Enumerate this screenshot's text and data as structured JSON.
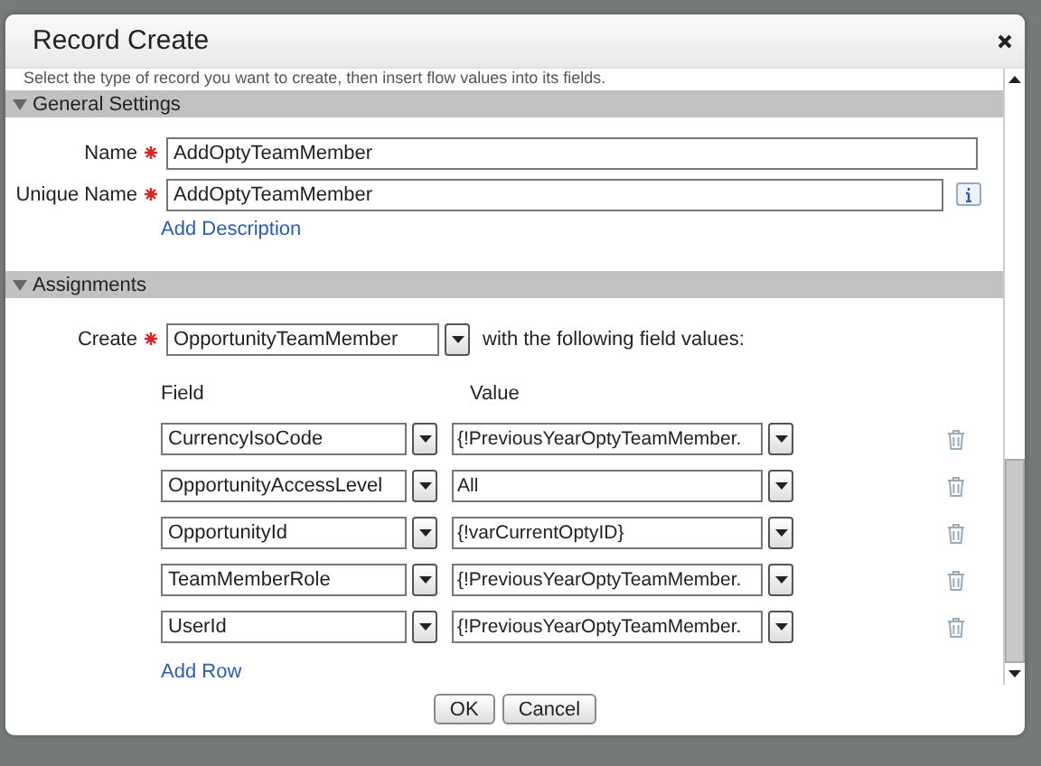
{
  "dialog": {
    "title": "Record Create"
  },
  "intro": "Select the type of record you want to create, then insert flow values into its fields.",
  "general": {
    "title": "General Settings",
    "expanded": true,
    "name": {
      "label": "Name",
      "required": true,
      "value": "AddOptyTeamMember"
    },
    "unique_name": {
      "label": "Unique Name",
      "required": true,
      "value": "AddOptyTeamMember"
    },
    "add_description": "Add Description"
  },
  "assignments": {
    "title": "Assignments",
    "expanded": true,
    "create": {
      "label": "Create",
      "required": true,
      "value": "OpportunityTeamMember",
      "suffix": "with the following field values:"
    },
    "columns": [
      "Field",
      "Value"
    ],
    "rows": [
      {
        "field": "CurrencyIsoCode",
        "value": "{!PreviousYearOptyTeamMember."
      },
      {
        "field": "OpportunityAccessLevel",
        "value": "All"
      },
      {
        "field": "OpportunityId",
        "value": "{!varCurrentOptyID}"
      },
      {
        "field": "TeamMemberRole",
        "value": "{!PreviousYearOptyTeamMember."
      },
      {
        "field": "UserId",
        "value": "{!PreviousYearOptyTeamMember."
      }
    ],
    "add_row": "Add Row"
  },
  "buttons": [
    "OK",
    "Cancel"
  ]
}
